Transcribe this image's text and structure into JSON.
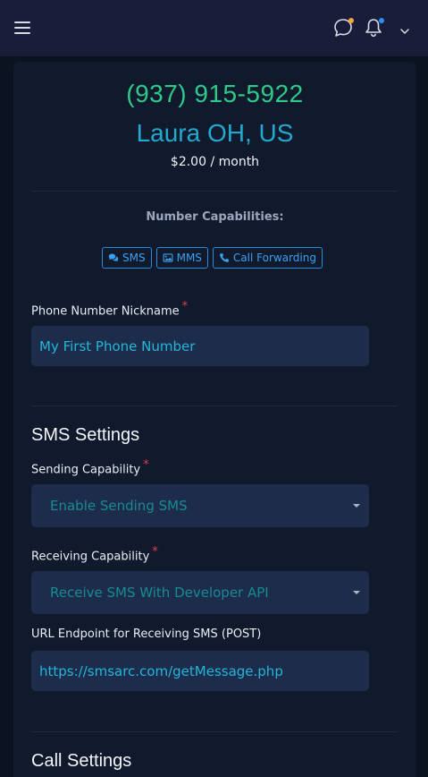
{
  "header": {
    "menu_icon": "hamburger-icon",
    "chat_icon": "chat-bubble-icon",
    "bell_icon": "bell-icon",
    "chevron_icon": "chevron-down-icon",
    "chat_dot_color": "#f0a63a",
    "bell_dot_color": "#2f8ef0"
  },
  "number": {
    "phone": "(937) 915-5922",
    "location": "Laura OH, US",
    "price": "$2.00 / month"
  },
  "capabilities": {
    "title": "Number Capabilities:",
    "badges": [
      {
        "label": "SMS",
        "icon": "chat-icon"
      },
      {
        "label": "MMS",
        "icon": "image-icon"
      },
      {
        "label": "Call Forwarding",
        "icon": "phone-icon"
      }
    ]
  },
  "nickname": {
    "label": "Phone Number Nickname",
    "required_mark": "*",
    "value": "My First Phone Number"
  },
  "sms_settings": {
    "title": "SMS Settings",
    "sending": {
      "label": "Sending Capability",
      "required_mark": "*",
      "selected": "Enable Sending SMS"
    },
    "receiving": {
      "label": "Receiving Capability",
      "required_mark": "*",
      "selected": "Receive SMS With Developer API"
    },
    "endpoint": {
      "label": "URL Endpoint for Receiving SMS (POST)",
      "value": "https://smsarc.com/getMessage.php"
    }
  },
  "call_settings": {
    "title": "Call Settings"
  },
  "colors": {
    "background": "#0b1220",
    "topbar": "#1a1d3a",
    "card": "#111a2c",
    "phone": "#2fc98a",
    "location": "#23a8d0",
    "badge": "#3aa0f0",
    "required": "#e23d4d",
    "field": "#1d2c4a"
  }
}
